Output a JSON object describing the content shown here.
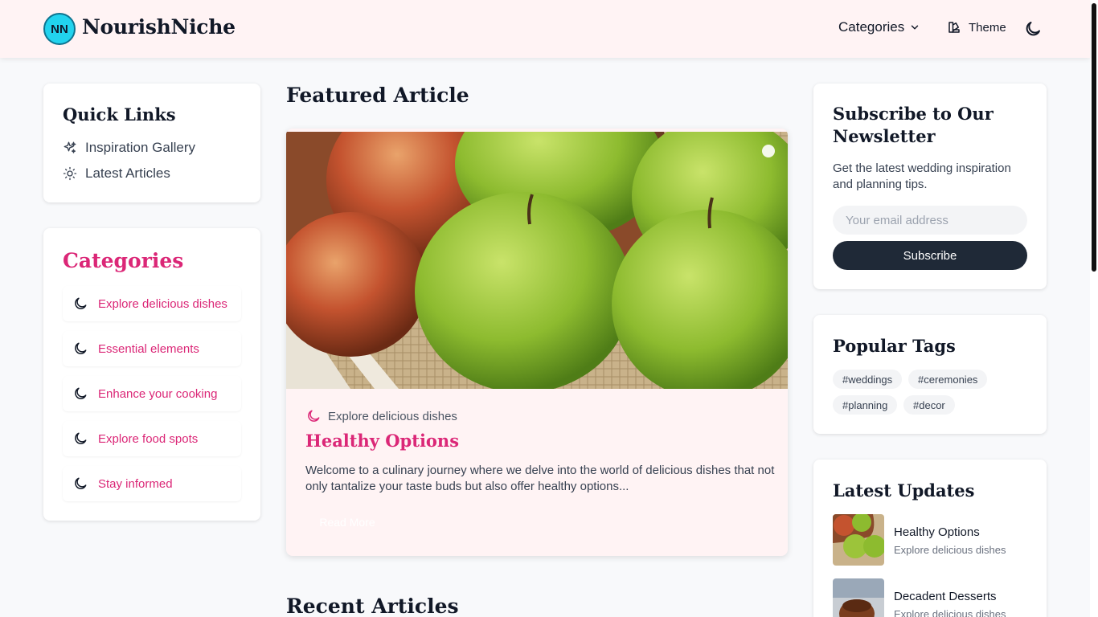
{
  "header": {
    "logo_initials": "NN",
    "logo_text": "NourishNiche",
    "nav_categories": "Categories",
    "nav_theme": "Theme"
  },
  "quick_links": {
    "title": "Quick Links",
    "items": [
      {
        "label": "Inspiration Gallery",
        "icon": "sparkles-icon"
      },
      {
        "label": "Latest Articles",
        "icon": "sun-icon"
      }
    ]
  },
  "categories": {
    "title": "Categories",
    "items": [
      {
        "label": "Explore delicious dishes",
        "icon": "moon-icon"
      },
      {
        "label": "Essential elements",
        "icon": "moon-icon"
      },
      {
        "label": "Enhance your cooking",
        "icon": "moon-icon"
      },
      {
        "label": "Explore food spots",
        "icon": "moon-icon"
      },
      {
        "label": "Stay informed",
        "icon": "moon-icon"
      }
    ]
  },
  "featured": {
    "section_title": "Featured Article",
    "category": "Explore delicious dishes",
    "title": "Healthy Options",
    "excerpt": "Welcome to a culinary journey where we delve into the world of delicious dishes that not only tantalize your taste buds but also offer healthy options...",
    "button": "Read More"
  },
  "recent": {
    "section_title": "Recent Articles"
  },
  "newsletter": {
    "title": "Subscribe to Our Newsletter",
    "description": "Get the latest wedding inspiration and planning tips.",
    "input_placeholder": "Your email address",
    "button": "Subscribe"
  },
  "tags": {
    "title": "Popular Tags",
    "items": [
      "#weddings",
      "#ceremonies",
      "#planning",
      "#decor"
    ]
  },
  "latest": {
    "title": "Latest Updates",
    "items": [
      {
        "title": "Healthy Options",
        "category": "Explore delicious dishes"
      },
      {
        "title": "Decadent Desserts",
        "category": "Explore delicious dishes"
      }
    ]
  },
  "colors": {
    "accent": "#db2777",
    "header_bg": "#fff3f4",
    "logo_badge": "#22d3ee",
    "button_dark": "#1f2937"
  }
}
